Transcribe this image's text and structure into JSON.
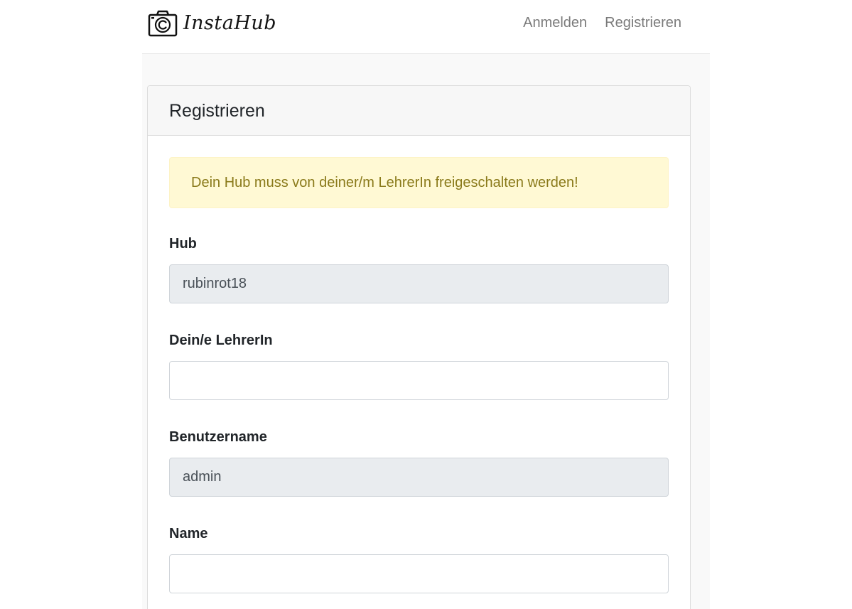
{
  "navbar": {
    "brand_name": "InstaHub",
    "brand_icon": "camera-icon",
    "links": [
      {
        "label": "Anmelden"
      },
      {
        "label": "Registrieren"
      }
    ]
  },
  "card": {
    "title": "Registrieren",
    "alert_text": "Dein Hub muss von deiner/m LehrerIn freigeschalten werden!"
  },
  "form": {
    "hub": {
      "label": "Hub",
      "value": "rubinrot18"
    },
    "teacher": {
      "label": "Dein/e LehrerIn",
      "value": ""
    },
    "username": {
      "label": "Benutzername",
      "value": "admin"
    },
    "name": {
      "label": "Name",
      "value": ""
    }
  },
  "colors": {
    "alert_background": "#fff9d4",
    "alert_text": "#8a7a1a",
    "readonly_input_background": "#e9ecef",
    "page_background": "#f9f9f9"
  }
}
